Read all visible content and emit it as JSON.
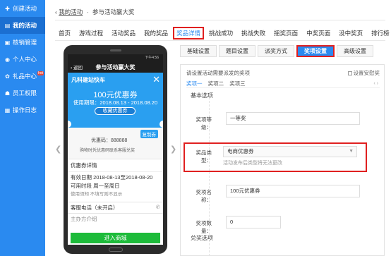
{
  "sidebar": {
    "items": [
      {
        "label": "创建活动",
        "icon": "plus-icon"
      },
      {
        "label": "我的活动",
        "icon": "list-icon",
        "active": true
      },
      {
        "label": "核销管理",
        "icon": "scan-icon"
      },
      {
        "label": "个人中心",
        "icon": "user-icon"
      },
      {
        "label": "礼品中心",
        "icon": "gift-icon",
        "badge": "hot"
      },
      {
        "label": "员工权限",
        "icon": "staff-icon"
      },
      {
        "label": "操作日志",
        "icon": "log-icon"
      }
    ]
  },
  "breadcrumb": {
    "back": "‹",
    "parent": "我的活动",
    "current": "参与活动赢大奖"
  },
  "topnav": [
    "首页",
    "游戏过程",
    "活动奖品",
    "我的奖品",
    "奖品详情",
    "挑战成功",
    "挑战失败",
    "摇奖页面",
    "中奖页面",
    "没中奖页",
    "排行榜"
  ],
  "phone": {
    "time": "下午4:56",
    "back": "‹ 返回",
    "title": "参与活动赢大奖",
    "shop": "凡科建站快车",
    "close": "✕",
    "amount": "100元优惠券",
    "period": "使用期限：2018.08.13 - 2018.08.20",
    "fav_btn": "收藏优惠券",
    "copy_btn": "复制券",
    "code": "优惠码：888888",
    "code_hint": "购物时凭优惠码联系客服兑奖",
    "detail_title": "优惠券详情",
    "valid": "有效日期 2018-08-13至2018-08-20",
    "days": "可用时段 周一至周日",
    "note": "使用须知 不填写则不显示",
    "service": "客服电话（未开启）",
    "cut_text": "主办方介绍",
    "mall_btn": "进入商城"
  },
  "subtabs": [
    "基础设置",
    "题目设置",
    "派奖方式",
    "奖项设置",
    "高级设置"
  ],
  "panel": {
    "desc": "请设置活动需要派发的奖项",
    "checkbox": "设置安慰奖",
    "prize_tabs": [
      "奖项一",
      "奖项二",
      "奖项三"
    ],
    "ctrl": "‹ ›",
    "group_basic": "基本选项",
    "level_label": "奖项等级：",
    "level_value": "一等奖",
    "type_label": "奖品类型：",
    "type_value": "电商优惠券",
    "type_hint": "活动发布后类型将无法更改",
    "name_label": "奖项名称：",
    "name_value": "100元优惠券",
    "count_label": "奖项数量：",
    "count_value": "0",
    "group_redeem": "兑奖选项"
  },
  "colors": {
    "sidebar": "#2a8af0",
    "accent": "#2a8af0",
    "highlight": "#e02020",
    "coupon": "#2a9ff0",
    "mall": "#1dbb3a"
  }
}
